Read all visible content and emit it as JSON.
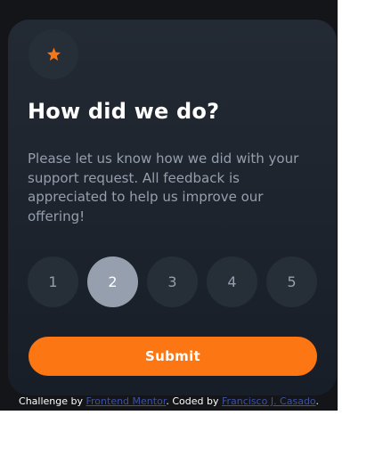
{
  "card": {
    "icon": "star-icon",
    "title": "How did we do?",
    "description": "Please let us know how we did with your support request. All feedback is appreciated to help us improve our offering!"
  },
  "ratings": {
    "options": [
      "1",
      "2",
      "3",
      "4",
      "5"
    ],
    "selected": "2"
  },
  "submit_label": "Submit",
  "attribution": {
    "prefix": "Challenge by ",
    "link1": "Frontend Mentor",
    "middle": ". Coded by ",
    "link2": "Francisco J. Casado",
    "suffix": "."
  },
  "colors": {
    "accent": "#fc7614",
    "card_bg": "#1f2630",
    "circle_bg": "#262e38",
    "selected_bg": "#969fad",
    "link": "#3e52a3"
  }
}
